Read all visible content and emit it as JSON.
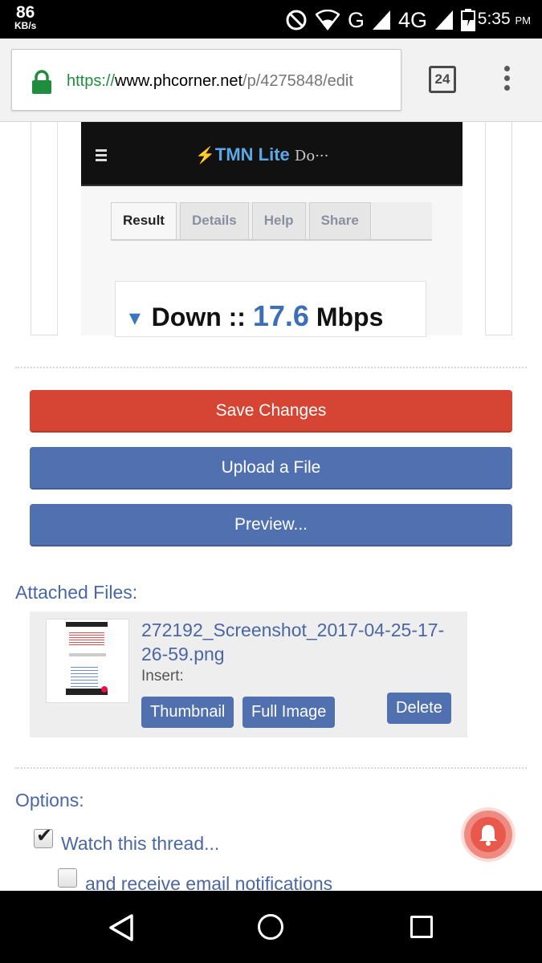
{
  "status_bar": {
    "net_speed": "86",
    "net_speed_unit": "KB/s",
    "network_g": "G",
    "network_4g": "4G",
    "time": "5:35",
    "ampm": "PM"
  },
  "browser": {
    "url_scheme": "https://",
    "url_host": "www.phcorner.net",
    "url_path": "/p/4275848/edit",
    "tab_count": "24"
  },
  "embedded_image": {
    "logo": "TMN Lite",
    "logo_suffix": "Do···",
    "tabs": [
      "Result",
      "Details",
      "Help",
      "Share"
    ],
    "down_label": "Down ::",
    "down_value": "17.6",
    "down_unit": "Mbps"
  },
  "buttons": {
    "save": "Save Changes",
    "upload": "Upload a File",
    "preview": "Preview..."
  },
  "attachments": {
    "heading": "Attached Files:",
    "filename": "272192_Screenshot_2017-04-25-17-26-59.png",
    "insert_label": "Insert:",
    "thumbnail_btn": "Thumbnail",
    "full_image_btn": "Full Image",
    "delete_btn": "Delete"
  },
  "options": {
    "heading": "Options:",
    "watch_thread": "Watch this thread...",
    "watch_checked": true,
    "email_notifications": "and receive email notifications",
    "email_checked": false
  },
  "colors": {
    "save_red": "#d64533",
    "button_blue": "#5170b0",
    "link_blue": "#4a67a5"
  }
}
